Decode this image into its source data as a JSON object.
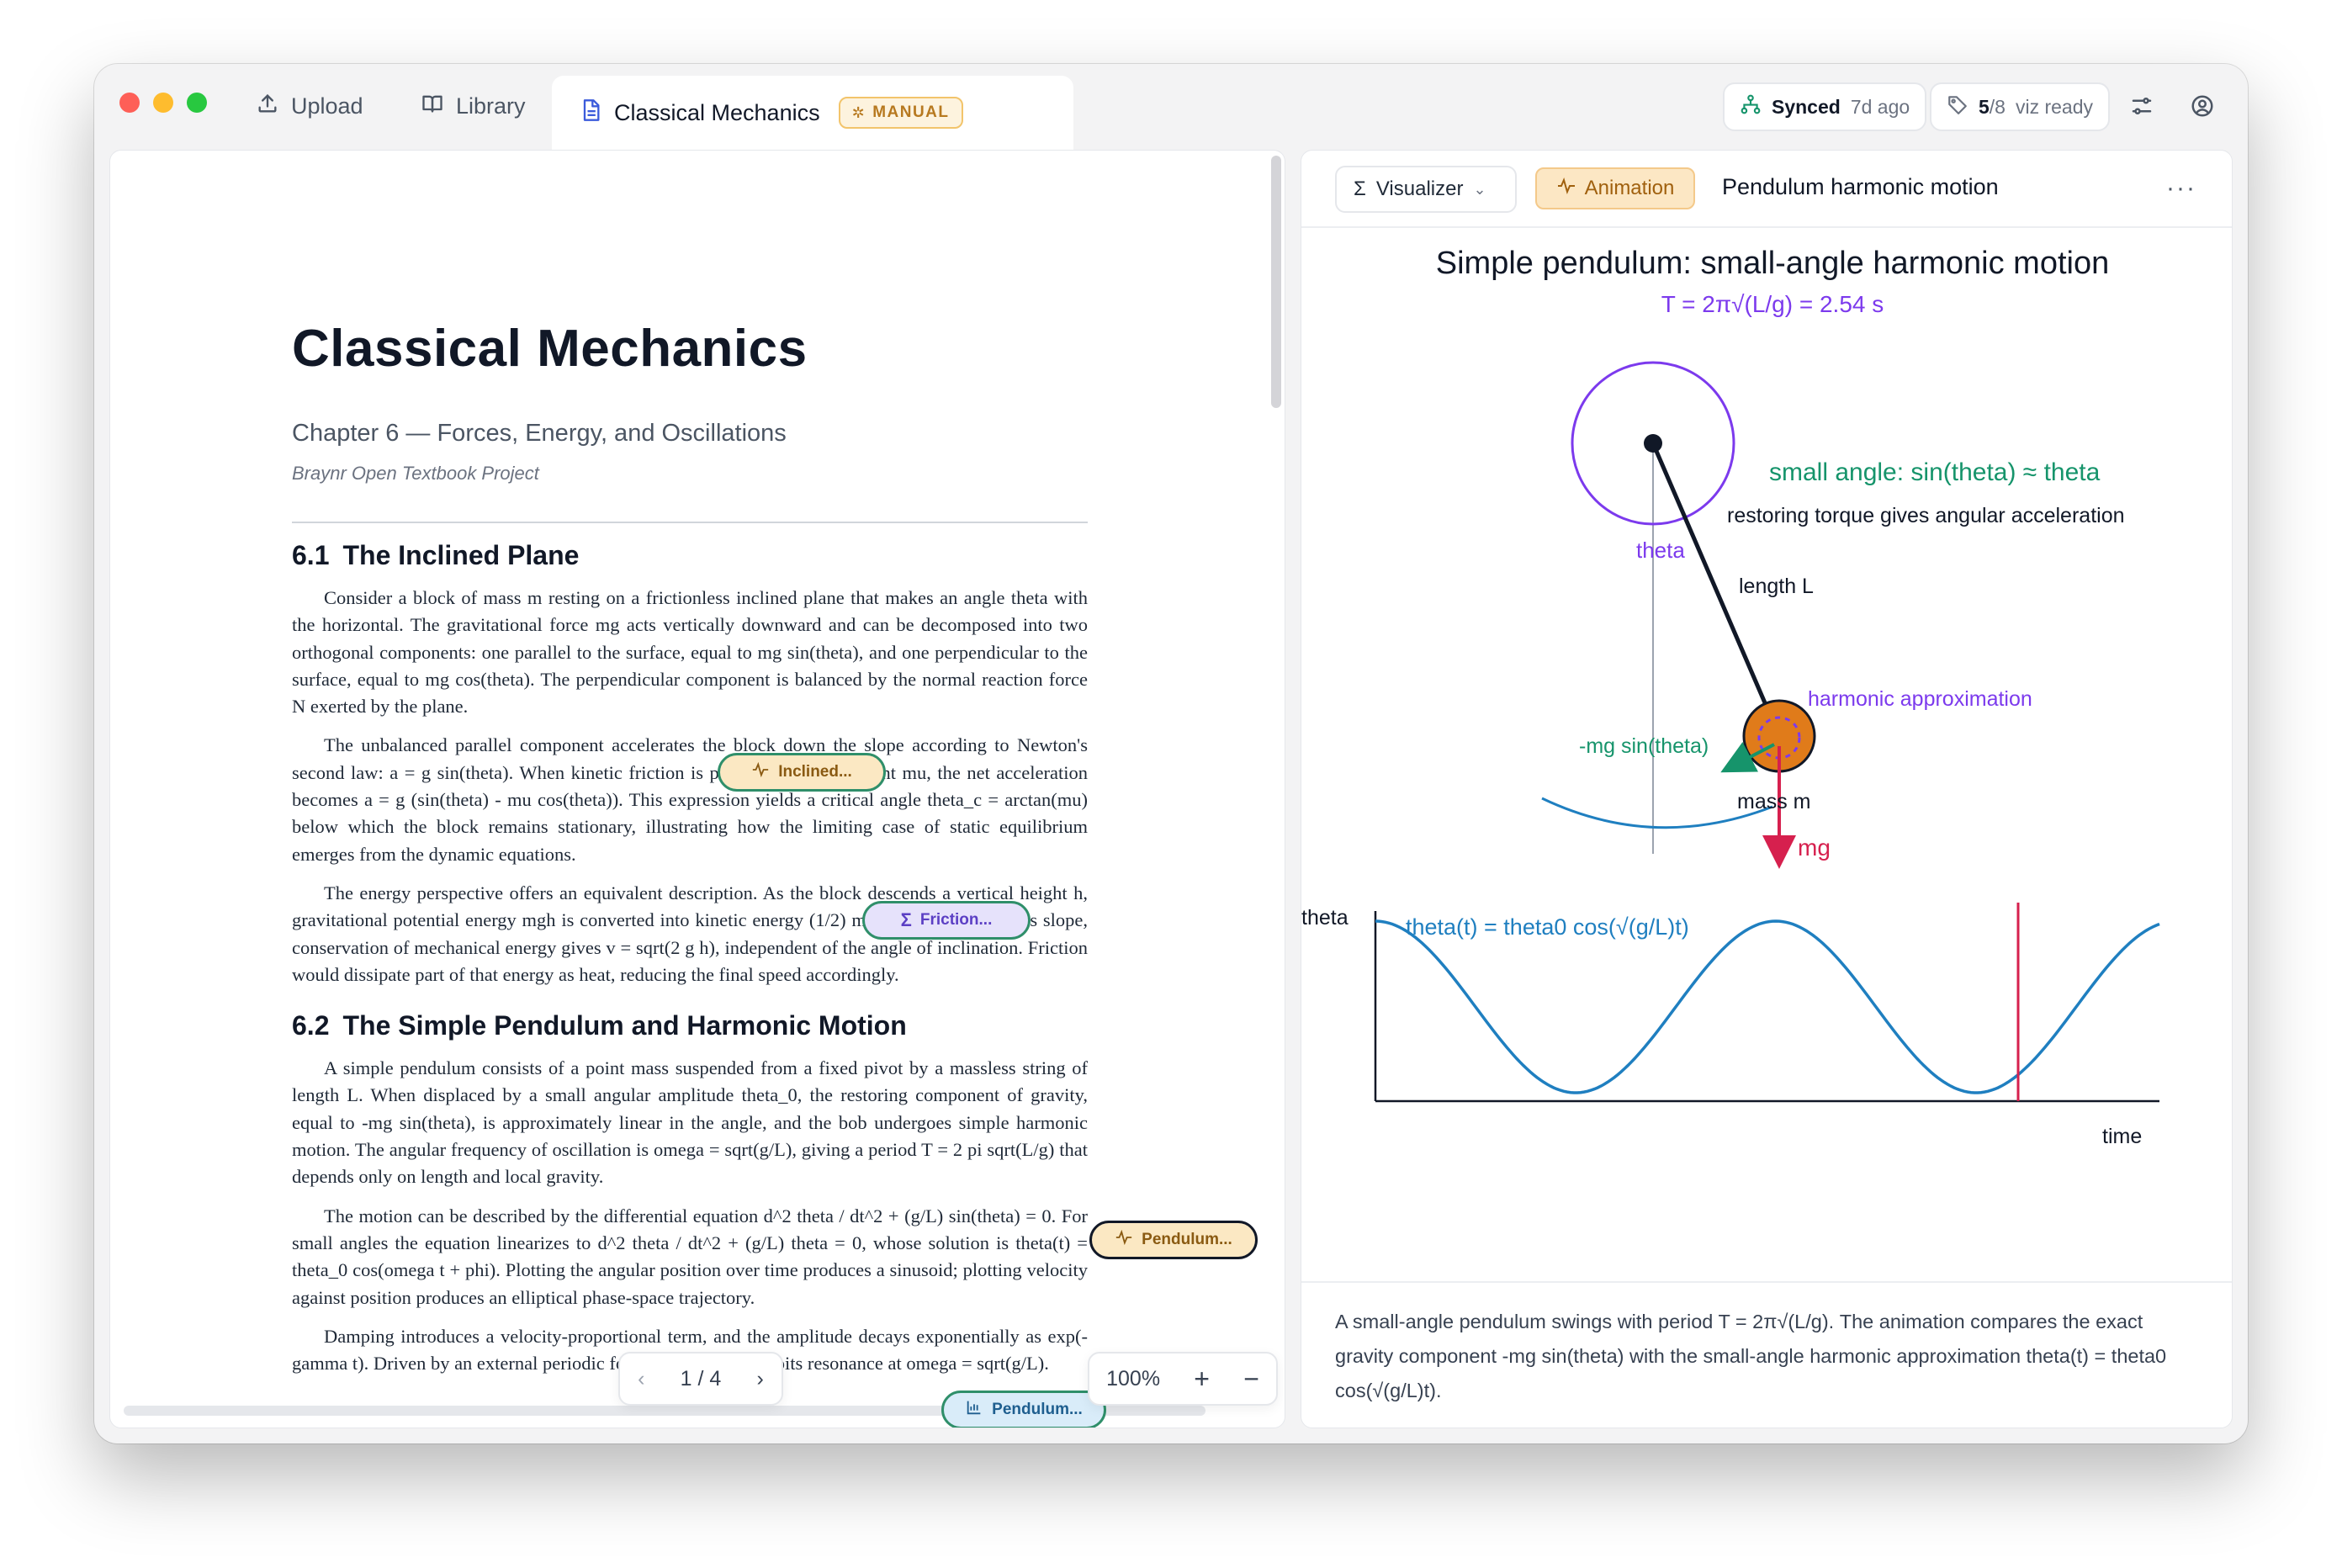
{
  "tabs": {
    "upload": "Upload",
    "library": "Library",
    "active": "Classical Mechanics",
    "manual_badge": "MANUAL"
  },
  "status": {
    "synced_label": "Synced",
    "synced_time": "7d ago",
    "viz_ready_count": "5",
    "viz_ready_total": "/8",
    "viz_ready_label": "viz ready"
  },
  "document": {
    "title": "Classical Mechanics",
    "subtitle": "Chapter 6 — Forces, Energy, and Oscillations",
    "project": "Braynr Open Textbook Project",
    "section1_num": "6.1",
    "section1_title": "The Inclined Plane",
    "p1": "Consider a block of mass m resting on a frictionless inclined plane that makes an angle theta with the horizontal. The gravitational force mg acts vertically downward and can be decomposed into two orthogonal components: one parallel to the surface, equal to mg sin(theta), and one perpendicular to the surface, equal to mg cos(theta). The perpendicular component is balanced by the normal reaction force N exerted by the plane.",
    "p2": "The unbalanced parallel component accelerates the block down the slope according to Newton's second law: a = g sin(theta). When kinetic friction is present, with coefficient mu, the net acceleration becomes a = g (sin(theta) - mu cos(theta)). This expression yields a critical angle theta_c = arctan(mu) below which the block remains stationary, illustrating how the limiting case of static equilibrium emerges from the dynamic equations.",
    "p3": "The energy perspective offers an equivalent description. As the block descends a vertical height h, gravitational potential energy mgh is converted into kinetic energy (1/2) m v^2. On a frictionless slope, conservation of mechanical energy gives v = sqrt(2 g h), independent of the angle of inclination. Friction would dissipate part of that energy as heat, reducing the final speed accordingly.",
    "section2_num": "6.2",
    "section2_title": "The Simple Pendulum and Harmonic Motion",
    "p4": "A simple pendulum consists of a point mass suspended from a fixed pivot by a massless string of length L. When displaced by a small angular amplitude theta_0, the restoring component of gravity, equal to -mg sin(theta), is approximately linear in the angle, and the bob undergoes simple harmonic motion. The angular frequency of oscillation is omega = sqrt(g/L), giving a period T = 2 pi sqrt(L/g) that depends only on length and local gravity.",
    "p5": "The motion can be described by the differential equation d^2 theta / dt^2 + (g/L) sin(theta) = 0. For small angles the equation linearizes to d^2 theta / dt^2 + (g/L) theta = 0, whose solution is theta(t) = theta_0 cos(omega t + phi). Plotting the angular position over time produces a sinusoid; plotting velocity against position produces an elliptical phase-space trajectory.",
    "p6": "Damping introduces a velocity-proportional term, and the amplitude decays exponentially as exp(-gamma t). Driven by an external periodic force, the system exhibits resonance at omega = sqrt(g/L)."
  },
  "chips": {
    "inclined": "Inclined...",
    "friction": "Friction...",
    "pendulum1": "Pendulum...",
    "pendulum2": "Pendulum..."
  },
  "pager": {
    "page": "1 / 4"
  },
  "zoom": {
    "level": "100%"
  },
  "viz": {
    "mode": "Visualizer",
    "kind": "Animation",
    "title": "Pendulum harmonic motion",
    "more": "···",
    "fig_title": "Simple pendulum: small-angle harmonic motion",
    "period": "T = 2π√(L/g) = 2.54 s",
    "small_angle": "small angle: sin(theta) ≈ theta",
    "torque": "restoring torque gives angular acceleration",
    "theta_label": "theta",
    "length_label": "length L",
    "harmonic_label": "harmonic approximation",
    "force_label": "-mg sin(theta)",
    "mass_label": "mass m",
    "mg_label": "mg",
    "plot_ylabel": "theta",
    "plot_xlabel": "time",
    "plot_eq": "theta(t) = theta0 cos(√(g/L)t)",
    "caption": "A small-angle pendulum swings with period T = 2π√(L/g). The animation compares the exact gravity component -mg sin(theta) with the small-angle harmonic approximation theta(t) = theta0 cos(√(g/L)t)."
  },
  "colors": {
    "purple": "#7c3aed",
    "green": "#16946b",
    "blue": "#1f7fc0",
    "red": "#d6204e",
    "bob": "#e07b1a"
  }
}
